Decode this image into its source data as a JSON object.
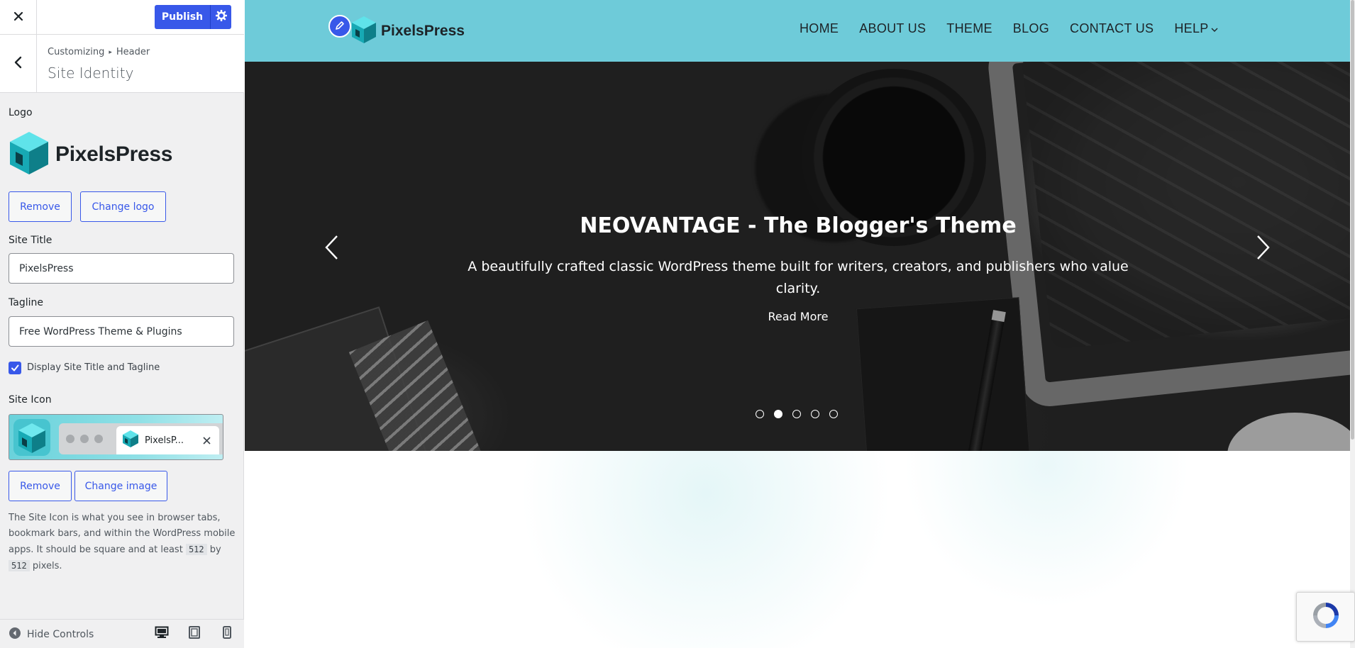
{
  "customizer": {
    "close_label": "Close",
    "publish_label": "Publish",
    "breadcrumb": [
      "Customizing",
      "Header"
    ],
    "section_title": "Site Identity",
    "logo": {
      "label": "Logo",
      "preview_name": "PixelsPress",
      "remove_label": "Remove",
      "change_label": "Change logo"
    },
    "site_title": {
      "label": "Site Title",
      "value": "PixelsPress"
    },
    "tagline": {
      "label": "Tagline",
      "value": "Free WordPress Theme & Plugins"
    },
    "display_title_tagline": {
      "label": "Display Site Title and Tagline",
      "checked": true
    },
    "site_icon": {
      "label": "Site Icon",
      "tab_title": "PixelsP...",
      "remove_label": "Remove",
      "change_label": "Change image",
      "description_parts": [
        "The Site Icon is what you see in browser tabs, bookmark bars, and within the WordPress mobile apps. It should be square and at least",
        "512",
        "by",
        "512",
        "pixels."
      ]
    },
    "footer": {
      "hide_controls_label": "Hide Controls"
    }
  },
  "site": {
    "logo_name": "PixelsPress",
    "nav": [
      "HOME",
      "ABOUT US",
      "THEME",
      "BLOG",
      "CONTACT US",
      "HELP"
    ],
    "hero": {
      "title": "NEOVANTAGE - The Blogger's Theme",
      "subtitle": "A beautifully crafted classic WordPress theme built for writers, creators, and publishers who value clarity.",
      "cta": "Read More",
      "slide_count": 5,
      "active_slide": 2
    }
  },
  "colors": {
    "accent": "#3858e9",
    "header_bg": "#6ecbd9",
    "logo_teal": "#1fb8c4"
  }
}
